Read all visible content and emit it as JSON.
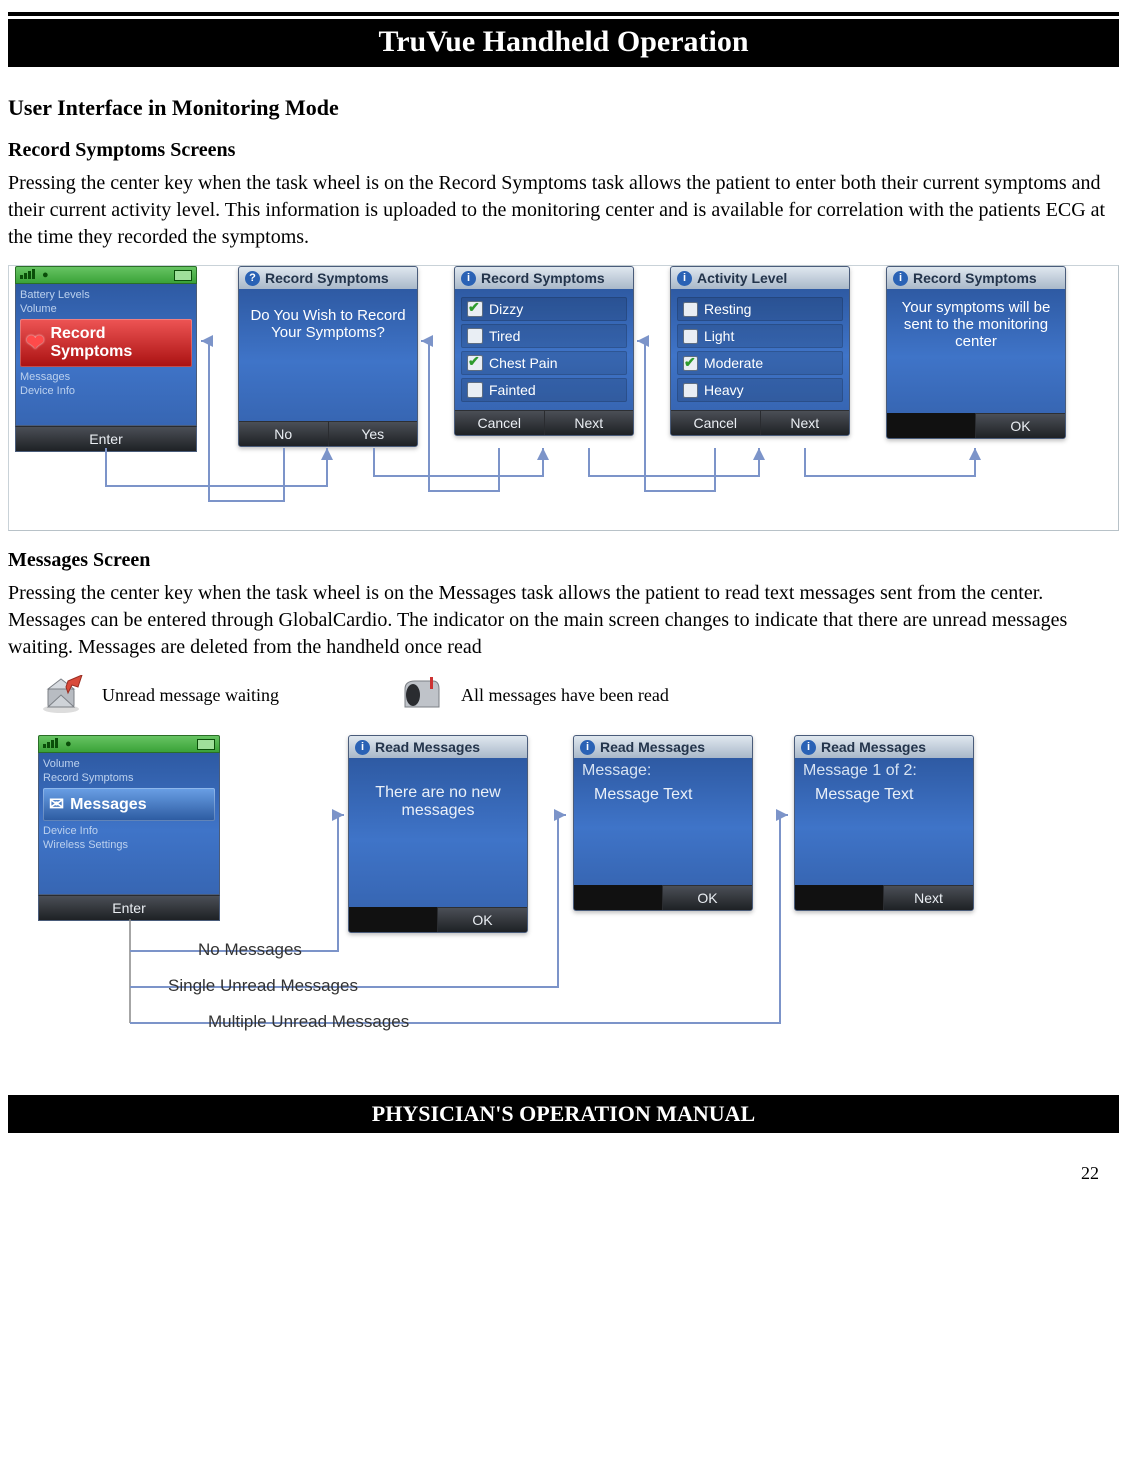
{
  "chapter_title": "TruVue Handheld Operation",
  "section_heading": "User Interface in Monitoring Mode",
  "rec_symp_heading": "Record Symptoms Screens",
  "rec_symp_body": "Pressing the center key when the task wheel is on the Record Symptoms task allows the patient to enter both their current symptoms and their current activity level. This information is uploaded to the monitoring center and is available for correlation with the patients ECG at the time they recorded the symptoms.",
  "wheel": {
    "items_above": [
      "Battery Levels",
      "Volume"
    ],
    "selected": "Record Symptoms",
    "items_below": [
      "Messages",
      "Device Info"
    ],
    "softkey": "Enter"
  },
  "confirm": {
    "title": "Record Symptoms",
    "body": "Do You Wish to Record Your Symptoms?",
    "left": "No",
    "right": "Yes"
  },
  "symptoms": {
    "title": "Record Symptoms",
    "items": [
      {
        "label": "Dizzy",
        "checked": true
      },
      {
        "label": "Tired",
        "checked": false
      },
      {
        "label": "Chest Pain",
        "checked": true
      },
      {
        "label": "Fainted",
        "checked": false
      }
    ],
    "left": "Cancel",
    "right": "Next"
  },
  "activity": {
    "title": "Activity Level",
    "items": [
      {
        "label": "Resting",
        "checked": false
      },
      {
        "label": "Light",
        "checked": false
      },
      {
        "label": "Moderate",
        "checked": true
      },
      {
        "label": "Heavy",
        "checked": false
      }
    ],
    "left": "Cancel",
    "right": "Next"
  },
  "sent": {
    "title": "Record Symptoms",
    "body": "Your symptoms will be sent to the monitoring center",
    "ok": "OK"
  },
  "messages_heading": "Messages Screen",
  "messages_body": "Pressing the center key when the task wheel is on the Messages task allows the patient to read text messages sent from the center. Messages can be entered through GlobalCardio. The indicator on the main screen changes to indicate that there are unread messages waiting. Messages are deleted from the handheld once read",
  "legend": {
    "unread": "Unread message waiting",
    "read": "All messages have been read"
  },
  "msg_wheel": {
    "items_above": [
      "Volume",
      "Record Symptoms"
    ],
    "selected": "Messages",
    "items_below": [
      "Device Info",
      "Wireless Settings"
    ],
    "softkey": "Enter"
  },
  "no_msgs": {
    "title": "Read Messages",
    "body": "There are no new messages",
    "ok": "OK"
  },
  "single_msg": {
    "title": "Read Messages",
    "header": "Message:",
    "body": "Message Text",
    "ok": "OK"
  },
  "multi_msg": {
    "title": "Read Messages",
    "header": "Message 1 of 2:",
    "body": "Message Text",
    "next": "Next"
  },
  "flow_labels": {
    "none": "No Messages",
    "single": "Single Unread Messages",
    "multi": "Multiple Unread Messages"
  },
  "footer": "PHYSICIAN'S OPERATION MANUAL",
  "page_number": "22"
}
